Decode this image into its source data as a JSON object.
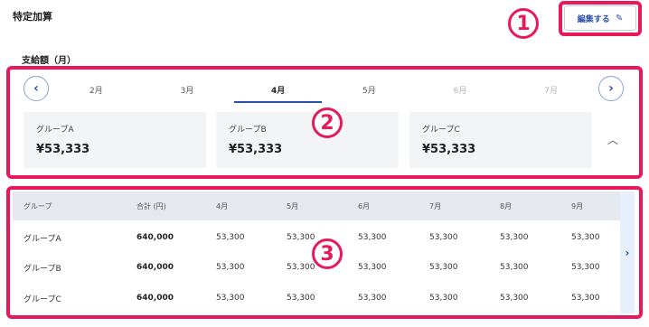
{
  "header": {
    "title": "特定加算",
    "edit_label": "編集する"
  },
  "annotations": {
    "badge1": "1",
    "badge2": "2",
    "badge3": "3"
  },
  "summary": {
    "label": "支給額（月）",
    "months": [
      "2月",
      "3月",
      "4月",
      "5月",
      "6月",
      "7月"
    ],
    "active_month": "4月",
    "cards": [
      {
        "name": "グループA",
        "amount": "¥53,333"
      },
      {
        "name": "グループB",
        "amount": "¥53,333"
      },
      {
        "name": "グループC",
        "amount": "¥53,333"
      }
    ]
  },
  "table": {
    "headers": [
      "グループ",
      "合計 (円)",
      "4月",
      "5月",
      "6月",
      "7月",
      "8月",
      "9月"
    ],
    "rows": [
      [
        "グループA",
        "640,000",
        "53,300",
        "53,300",
        "53,300",
        "53,300",
        "53,300",
        "53,300"
      ],
      [
        "グループB",
        "640,000",
        "53,300",
        "53,300",
        "53,300",
        "53,300",
        "53,300",
        "53,300"
      ],
      [
        "グループC",
        "640,000",
        "53,300",
        "53,300",
        "53,300",
        "53,300",
        "53,300",
        "53,300"
      ]
    ]
  },
  "icons": {
    "edit": "pencil-icon",
    "prev": "chevron-left-icon",
    "next": "chevron-right-icon",
    "collapse": "chevron-up-icon",
    "scroll": "chevron-right-icon"
  },
  "colors": {
    "accent": "#2a4fa8",
    "highlight": "#e8195a",
    "card_bg": "#f3f4f6",
    "table_header_bg": "#e5e8ed"
  }
}
